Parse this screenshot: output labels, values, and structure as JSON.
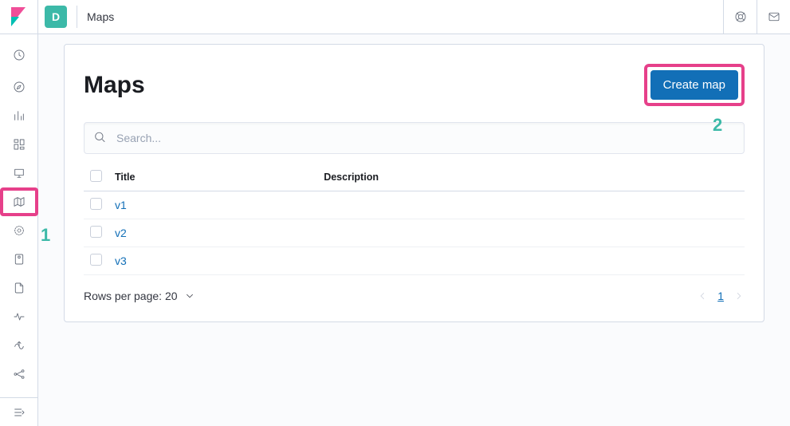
{
  "space_initial": "D",
  "breadcrumb": "Maps",
  "page_title": "Maps",
  "create_button": "Create map",
  "search": {
    "placeholder": "Search..."
  },
  "table": {
    "headers": {
      "title": "Title",
      "description": "Description"
    },
    "rows": [
      {
        "title": "v1",
        "description": ""
      },
      {
        "title": "v2",
        "description": ""
      },
      {
        "title": "v3",
        "description": ""
      }
    ]
  },
  "footer": {
    "rows_per_page_label": "Rows per page: 20",
    "current_page": "1"
  },
  "annotations": {
    "one": "1",
    "two": "2"
  }
}
